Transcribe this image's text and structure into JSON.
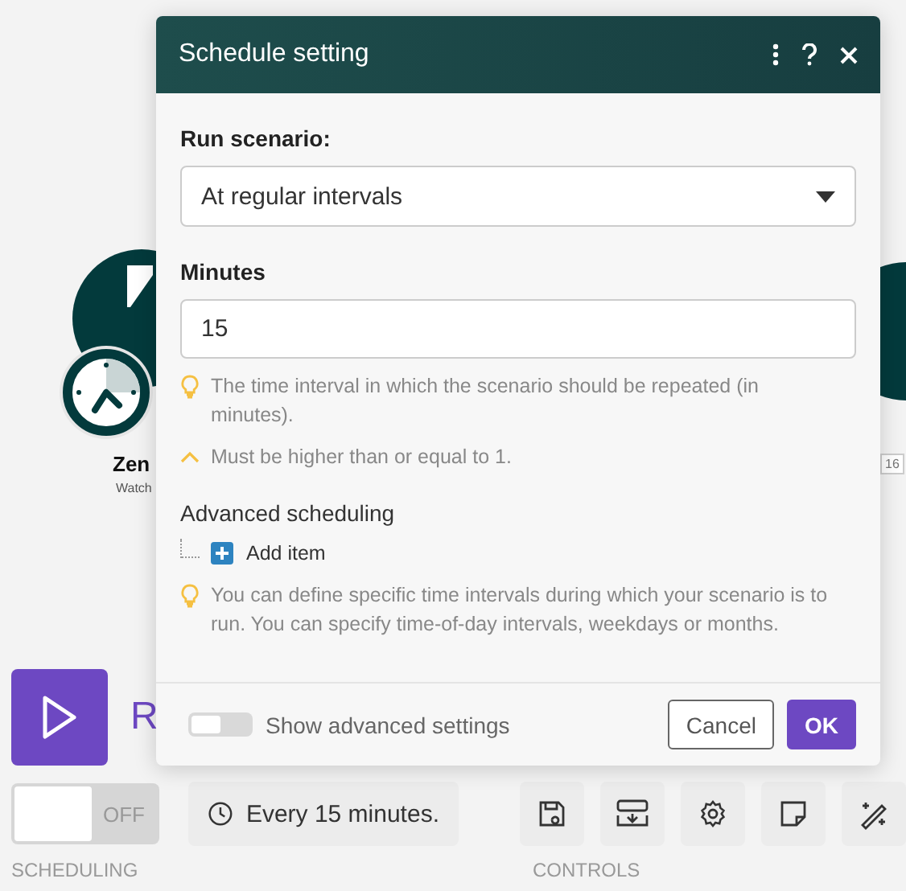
{
  "canvas": {
    "modules": [
      {
        "kind": "trigger",
        "title": "Zen",
        "subtitle": "Watch"
      },
      {
        "kind": "plain",
        "badge": "16"
      }
    ]
  },
  "dialog": {
    "title": "Schedule setting",
    "run_scenario": {
      "label": "Run scenario:",
      "value": "At regular intervals"
    },
    "minutes": {
      "label": "Minutes",
      "value": "15",
      "hint": "The time interval in which the scenario should be repeated (in minutes).",
      "validation": "Must be higher than or equal to 1."
    },
    "advanced_scheduling": {
      "label": "Advanced scheduling",
      "add_item": "Add item",
      "hint": "You can define specific time intervals during which your scenario is to run. You can specify time-of-day intervals, weekdays or months."
    },
    "footer": {
      "advanced_toggle": {
        "label": "Show advanced settings",
        "on": false
      },
      "buttons": [
        {
          "kind": "secondary",
          "label": "Cancel"
        },
        {
          "kind": "primary",
          "label": "OK"
        }
      ]
    }
  },
  "toolbar": {
    "run_label": "R",
    "scheduling": {
      "toggle": {
        "label": "OFF",
        "on": false
      },
      "schedule": "Every 15 minutes.",
      "section_label": "SCHEDULING"
    },
    "controls": {
      "section_label": "CONTROLS"
    }
  }
}
